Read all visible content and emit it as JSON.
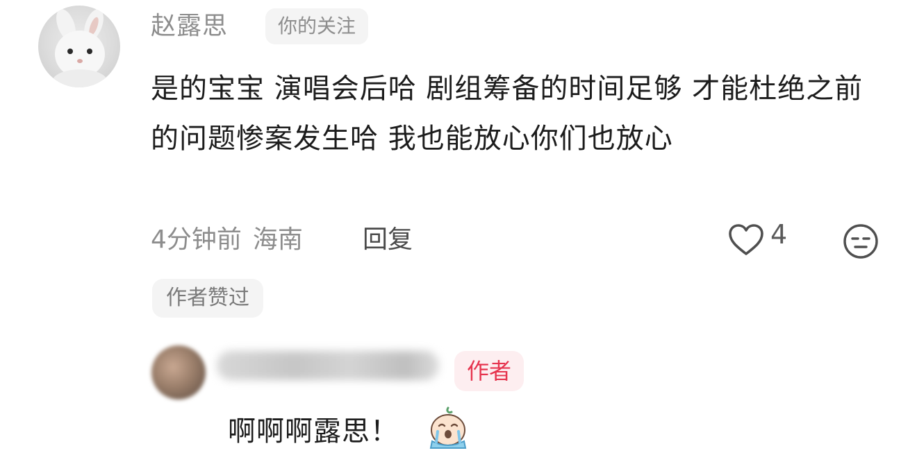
{
  "comment": {
    "username": "赵露思",
    "follow_badge": "你的关注",
    "text": "是的宝宝 演唱会后哈 剧组筹备的时间足够 才能杜绝之前的问题惨案发生哈 我也能放心你们也放心",
    "time": "4分钟前",
    "location": "海南",
    "reply_label": "回复",
    "like_count": "4",
    "author_liked_badge": "作者赞过",
    "avatar_icon": "rabbit-avatar-icon"
  },
  "reply": {
    "author_badge": "作者",
    "text": "啊啊啊露思！",
    "emoji_icon": "crying-emoji-icon"
  },
  "colors": {
    "meta_gray": "#8d8d8d",
    "badge_bg": "#f4f4f4",
    "author_red": "#e6344e",
    "author_badge_bg": "#fdeef0",
    "text_dark": "#1c1c1c"
  }
}
